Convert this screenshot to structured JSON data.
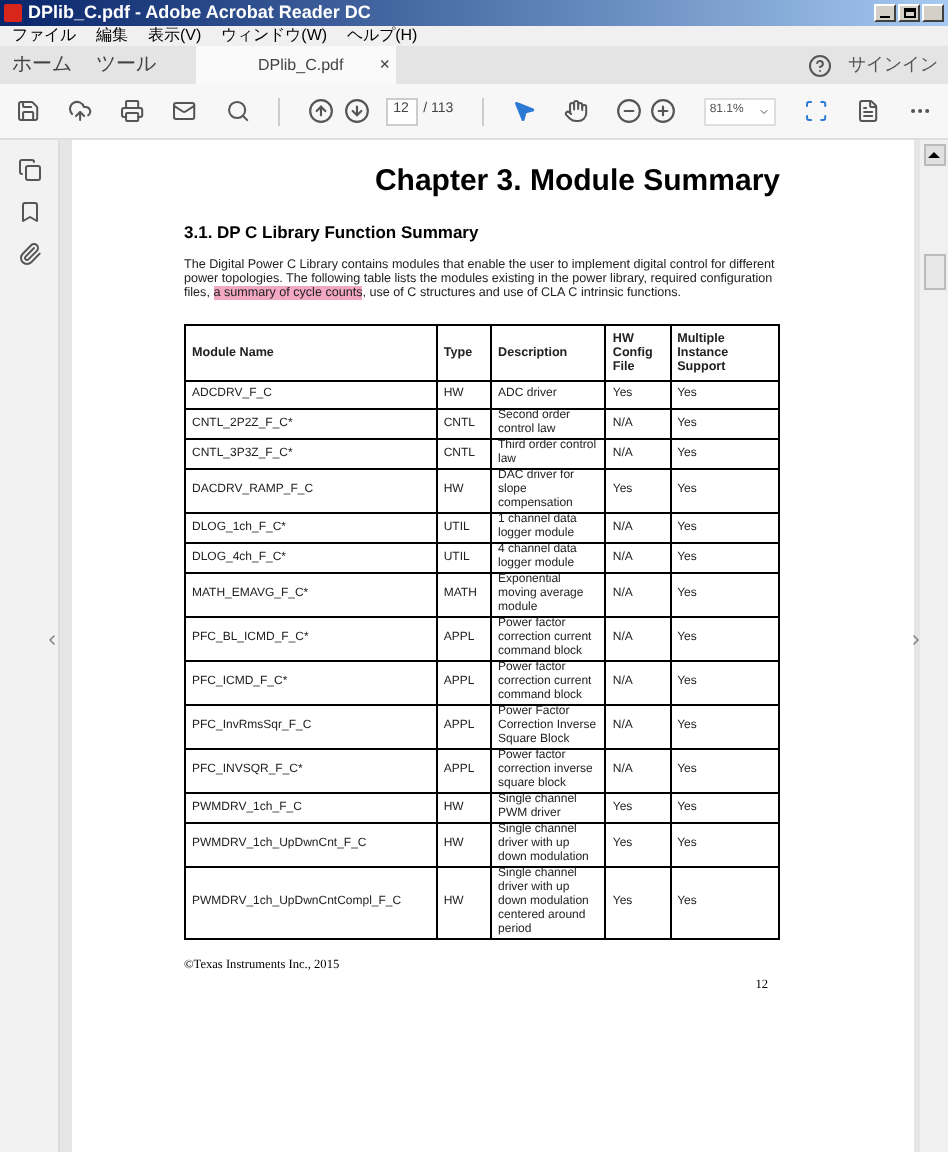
{
  "window": {
    "title": "DPlib_C.pdf - Adobe Acrobat Reader DC"
  },
  "menu": [
    "ファイル",
    "編集",
    "表示(V)",
    "ウィンドウ(W)",
    "ヘルプ(H)"
  ],
  "tabs": [
    {
      "label": "ホーム",
      "kind": "nav",
      "selected": false
    },
    {
      "label": "ツール",
      "kind": "nav",
      "selected": false
    },
    {
      "label": "DPlib_C.pdf",
      "kind": "document",
      "selected": true
    }
  ],
  "close_tab": "×",
  "sign_in": "サインイン",
  "toolbar": {
    "page": "12",
    "total": "/ 113",
    "zoom": "81.1%",
    "tools": [
      {
        "kind": "select",
        "selected": true
      },
      {
        "kind": "hand",
        "selected": false
      }
    ]
  },
  "document": {
    "chapter": "Chapter 3.  Module Summary",
    "section": "3.1.  DP C Library Function Summary",
    "paragraph": {
      "before": "The Digital Power  C Library contains modules that enable the user to implement digital control for different power topologies. The following table lists the modules existing in the power library, required configuration files, ",
      "highlight": "a summary of cycle counts",
      "after": ", use of C structures and use of CLA C intrinsic functions."
    },
    "table": {
      "columns": [
        "Module Name",
        "Type",
        "Description",
        "HW Config File",
        "Multiple Instance Support"
      ],
      "rows": [
        [
          "ADCDRV_F_C",
          "HW",
          "ADC driver",
          "Yes",
          "Yes"
        ],
        [
          "CNTL_2P2Z_F_C*",
          "CNTL",
          "Second order control law",
          "N/A",
          "Yes"
        ],
        [
          "CNTL_3P3Z_F_C*",
          "CNTL",
          "Third order control law",
          "N/A",
          "Yes"
        ],
        [
          "DACDRV_RAMP_F_C",
          "HW",
          "DAC driver for slope compensation",
          "Yes",
          "Yes"
        ],
        [
          "DLOG_1ch_F_C*",
          "UTIL",
          "1 channel data logger module",
          "N/A",
          "Yes"
        ],
        [
          "DLOG_4ch_F_C*",
          "UTIL",
          "4 channel data logger module",
          "N/A",
          "Yes"
        ],
        [
          "MATH_EMAVG_F_C*",
          "MATH",
          "Exponential moving average module",
          "N/A",
          "Yes"
        ],
        [
          "PFC_BL_ICMD_F_C*",
          "APPL",
          "Power factor correction current command block",
          "N/A",
          "Yes"
        ],
        [
          "PFC_ICMD_F_C*",
          "APPL",
          "Power factor correction current command block",
          "N/A",
          "Yes"
        ],
        [
          "PFC_InvRmsSqr_F_C",
          "APPL",
          "Power Factor Correction Inverse Square Block",
          "N/A",
          "Yes"
        ],
        [
          "PFC_INVSQR_F_C*",
          "APPL",
          "Power factor correction inverse square block",
          "N/A",
          "Yes"
        ],
        [
          "PWMDRV_1ch_F_C",
          "HW",
          "Single channel PWM driver",
          "Yes",
          "Yes"
        ],
        [
          "PWMDRV_1ch_UpDwnCnt_F_C",
          "HW",
          "Single channel driver with up down modulation",
          "Yes",
          "Yes"
        ],
        [
          "PWMDRV_1ch_UpDwnCntCompl_F_C",
          "HW",
          "Single channel driver with up down modulation centered around period",
          "Yes",
          "Yes"
        ]
      ]
    },
    "footer": "©Texas Instruments Inc., 2015",
    "page_number": "12"
  }
}
